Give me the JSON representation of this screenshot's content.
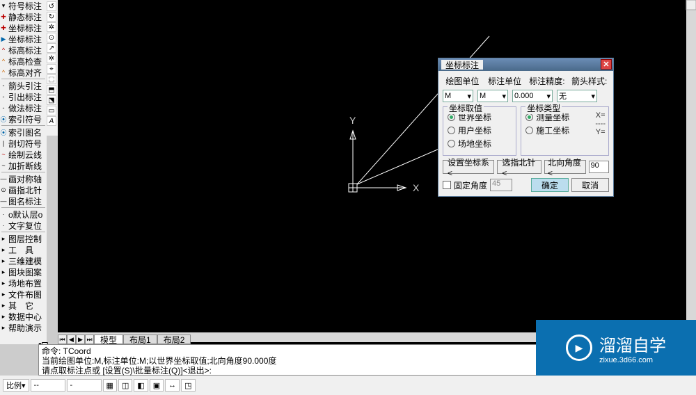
{
  "sidebar": {
    "groups": [
      [
        "符号标注",
        "静态标注",
        "坐标标注",
        "坐标标注",
        "标高标注",
        "标高检查",
        "标高对齐"
      ],
      [
        "箭头引注",
        "引出标注",
        "做法标注",
        "索引符号"
      ],
      [
        "索引图名",
        "剖切符号",
        "绘制云线",
        "加折断线"
      ],
      [
        "画对称轴",
        "画指北针",
        "图名标注"
      ],
      [
        "o默认层o",
        "文字复位"
      ],
      [
        "图层控制",
        "工　具",
        "三维建模",
        "图块图案",
        "场地布置",
        "文件布图",
        "其　它",
        "数据中心",
        "帮助演示"
      ]
    ]
  },
  "tabs": {
    "items": [
      "模型",
      "布局1",
      "布局2"
    ]
  },
  "cmd": {
    "l1": "命令: TCoord",
    "l2": "当前绘图单位:M,标注单位:M;以世界坐标取值;北向角度90.000度",
    "l3": "请点取标注点或 [设置(S)\\批量标注(Q)]<退出>:"
  },
  "status": {
    "ratio": "比例",
    "v1": "--",
    "v2": "-"
  },
  "axes": {
    "x": "X",
    "y": "Y"
  },
  "dialog": {
    "title": "坐标标注",
    "headers": [
      "绘图单位",
      "标注单位",
      "标注精度:",
      "箭头样式:"
    ],
    "sel1": "M",
    "sel2": "M",
    "sel3": "0.000",
    "sel4": "无",
    "grp1": "坐标取值",
    "grp1_items": [
      "世界坐标",
      "用户坐标",
      "场地坐标"
    ],
    "grp2": "坐标类型",
    "grp2_items": [
      "测量坐标",
      "施工坐标"
    ],
    "fmt_top": "X=",
    "fmt_mid": "----",
    "fmt_bot": "Y=",
    "btn_set": "设置坐标系<",
    "btn_north": "选指北针<",
    "angle_label": "北向角度<",
    "angle_val": "90",
    "chk_label": "固定角度",
    "fixed_angle": "45",
    "ok": "确定",
    "cancel": "取消"
  },
  "watermark": {
    "brand": "溜溜自学",
    "url": "zixue.3d66.com"
  }
}
